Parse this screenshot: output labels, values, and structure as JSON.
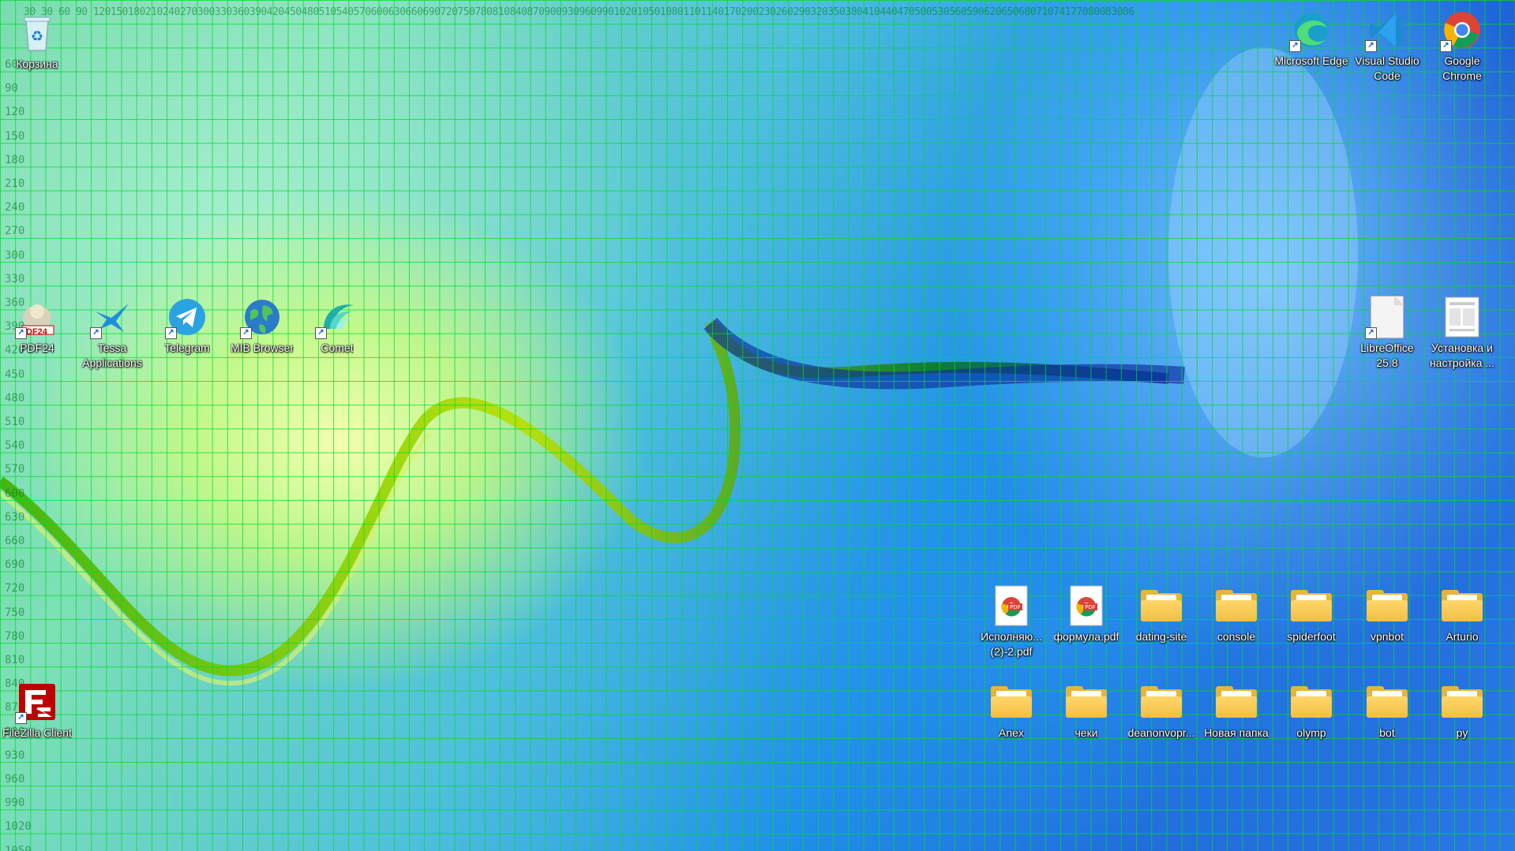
{
  "desktop": {
    "ruler_top": "30 30  60  90  120150180210240270300330360390420450480510540570600630660690720750780810840870900930960990102010501080110114017020023026029032035038041044047050053056059062065068071074177080083086",
    "ruler_left": [
      "60",
      "90",
      "120",
      "150",
      "180",
      "210",
      "240",
      "270",
      "300",
      "330",
      "360",
      "390",
      "420",
      "450",
      "480",
      "510",
      "540",
      "570",
      "600",
      "630",
      "660",
      "690",
      "720",
      "750",
      "780",
      "810",
      "840",
      "870",
      "900",
      "930",
      "960",
      "990",
      "1020",
      "1050"
    ],
    "icons": {
      "recycle_bin": {
        "label": "Корзина",
        "icon": "recycle-bin-icon"
      },
      "edge": {
        "label": "Microsoft Edge",
        "icon": "edge-icon"
      },
      "vscode": {
        "label": "Visual Studio Code",
        "icon": "vscode-icon"
      },
      "chrome": {
        "label": "Google Chrome",
        "icon": "chrome-icon"
      },
      "pdf24": {
        "label": "PDF24",
        "icon": "pdf24-icon",
        "badge": "DF24"
      },
      "tessa": {
        "label": "Tessa Applications",
        "icon": "tessa-icon"
      },
      "telegram": {
        "label": "Telegram",
        "icon": "telegram-icon"
      },
      "mib": {
        "label": "MIB Browser",
        "icon": "globe-icon"
      },
      "comet": {
        "label": "Comet",
        "icon": "comet-icon"
      },
      "libreoffice": {
        "label": "LibreOffice 25.8",
        "icon": "libreoffice-icon"
      },
      "setup": {
        "label": "Установка и настройка ...",
        "icon": "document-icon"
      },
      "filezilla": {
        "label": "FileZilla Client",
        "icon": "filezilla-icon"
      },
      "ispolnyayu": {
        "label": "Исполняю... (2)-2.pdf",
        "icon": "pdf-file-icon"
      },
      "formula": {
        "label": "формула.pdf",
        "icon": "pdf-file-icon"
      },
      "dating_site": {
        "label": "dating-site",
        "icon": "folder-icon"
      },
      "console": {
        "label": "console",
        "icon": "folder-icon"
      },
      "spiderfoot": {
        "label": "spiderfoot",
        "icon": "folder-icon"
      },
      "vpnbot": {
        "label": "vpnbot",
        "icon": "folder-icon"
      },
      "arturio": {
        "label": "Arturio",
        "icon": "folder-icon"
      },
      "anex": {
        "label": "Anex",
        "icon": "folder-icon"
      },
      "cheki": {
        "label": "чеки",
        "icon": "folder-icon"
      },
      "deanonvopr": {
        "label": "deanonvopr...",
        "icon": "folder-icon"
      },
      "new_folder": {
        "label": "Новая папка",
        "icon": "folder-icon"
      },
      "olymp": {
        "label": "olymp",
        "icon": "folder-icon"
      },
      "bot": {
        "label": "bot",
        "icon": "folder-icon"
      },
      "py": {
        "label": "py",
        "icon": "folder-icon"
      }
    },
    "colors": {
      "grid": "#00dc28",
      "folder": "#f2be44",
      "wallpaper_blue": "#1f62d6",
      "wallpaper_green": "#c8f070"
    }
  }
}
